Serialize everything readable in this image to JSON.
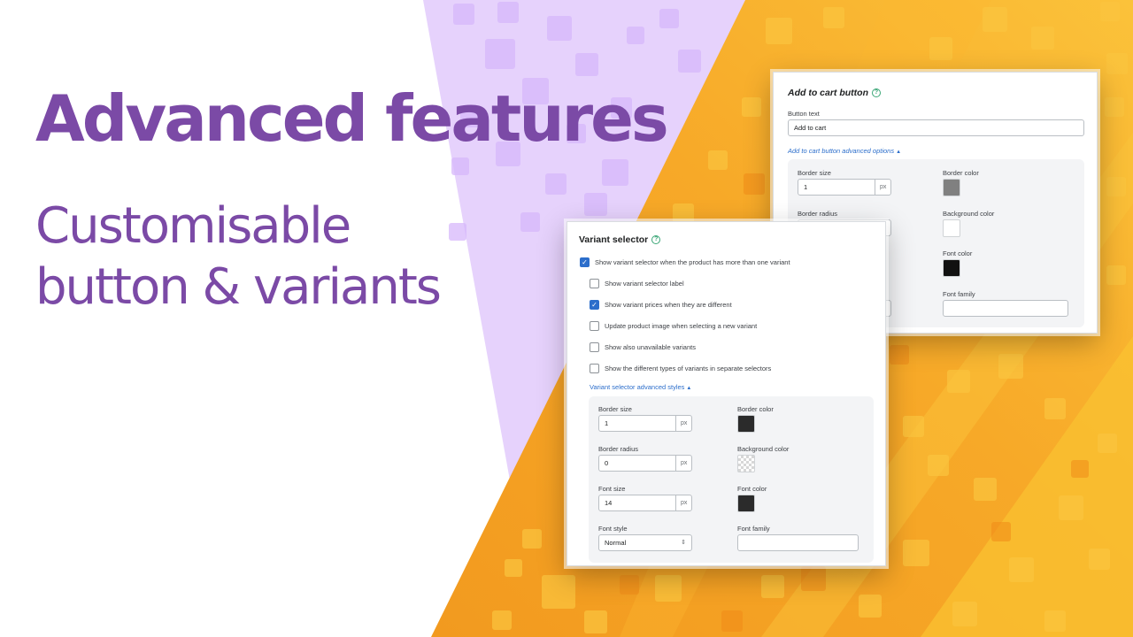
{
  "headline": {
    "title": "Advanced features",
    "subtitle_line1": "Customisable",
    "subtitle_line2": "button & variants"
  },
  "colors": {
    "brand_purple": "#7b4aa6",
    "lavender": "#e6d2fc",
    "orange": "#f7a326",
    "yellow": "#f9c232",
    "link_blue": "#2c6ecb",
    "help_green": "#3aa676"
  },
  "add_to_cart_panel": {
    "title": "Add to cart button",
    "help_icon": "question-circle-icon",
    "button_text_label": "Button text",
    "button_text_value": "Add to cart",
    "advanced_link": "Add to cart button advanced options",
    "advanced_arrow": "▲",
    "border_size_label": "Border size",
    "border_size_value": "1",
    "unit": "px",
    "border_color_label": "Border color",
    "border_color": "#808080",
    "border_radius_label": "Border radius",
    "background_color_label": "Background color",
    "background_color": "#ffffff",
    "font_color_label": "Font color",
    "font_color": "#111111",
    "font_family_label": "Font family"
  },
  "variant_panel": {
    "title": "Variant selector",
    "help_icon": "question-circle-icon",
    "checkboxes": [
      {
        "label": "Show variant selector when the product has more than one variant",
        "checked": true
      },
      {
        "label": "Show variant selector label",
        "checked": false
      },
      {
        "label": "Show variant prices when they are different",
        "checked": true
      },
      {
        "label": "Update product image when selecting a new variant",
        "checked": false
      },
      {
        "label": "Show also unavailable variants",
        "checked": false
      },
      {
        "label": "Show the different types of variants in separate selectors",
        "checked": false
      }
    ],
    "advanced_link": "Variant selector advanced styles",
    "advanced_arrow": "▲",
    "border_size_label": "Border size",
    "border_size_value": "1",
    "border_color_label": "Border color",
    "border_color": "#2b2b2b",
    "border_radius_label": "Border radius",
    "border_radius_value": "0",
    "background_color_label": "Background color",
    "background_color": "transparent",
    "font_size_label": "Font size",
    "font_size_value": "14",
    "font_color_label": "Font color",
    "font_color": "#2b2b2b",
    "font_style_label": "Font style",
    "font_style_value": "Normal",
    "font_family_label": "Font family",
    "unit": "px",
    "select_icon": "updown-caret-icon"
  }
}
